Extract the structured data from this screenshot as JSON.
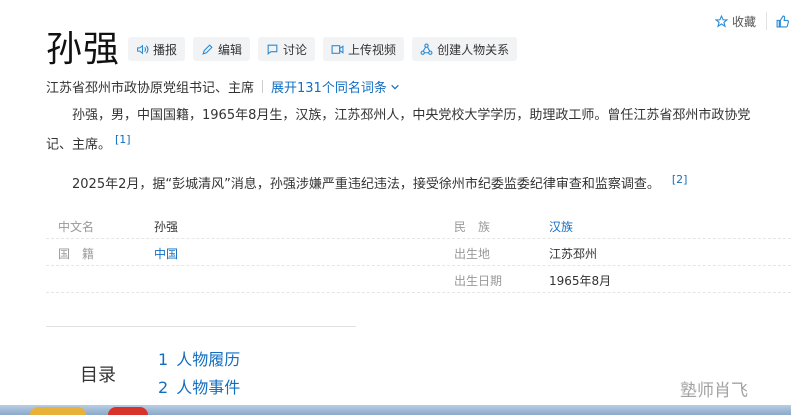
{
  "header": {
    "favorite_label": "收藏",
    "favorite_icon": "star-icon",
    "like_icon": "thumbs-up-icon"
  },
  "entry": {
    "title": "孙强",
    "toolbar": [
      {
        "icon": "speaker-icon",
        "label": "播报"
      },
      {
        "icon": "pencil-icon",
        "label": "编辑"
      },
      {
        "icon": "chat-icon",
        "label": "讨论"
      },
      {
        "icon": "video-icon",
        "label": "上传视频"
      },
      {
        "icon": "relation-icon",
        "label": "创建人物关系"
      }
    ],
    "subtitle": "江苏省邳州市政协原党组书记、主席",
    "expand_label": "展开131个同名词条"
  },
  "summary": {
    "p1_line1": "孙强，男，中国国籍，1965年8月生，汉族，江苏邳州人，中央党校大学学历，助理政工师。曾任江苏省邳州市政协党",
    "p1_line2": "记、主席。",
    "p1_ref": "[1]",
    "p2": "2025年2月，据“彭城清风”消息，孙强涉嫌严重违纪违法，接受徐州市纪委监委纪律审查和监察调查。",
    "p2_ref": "[2]"
  },
  "basic_info": {
    "rows": [
      {
        "k1": "中文名",
        "v1": "孙强",
        "k2": "民　族",
        "v2": "汉族"
      },
      {
        "k1": "国　籍",
        "v1": "中国",
        "k2": "出生地",
        "v2": "江苏邳州"
      },
      {
        "k1": "",
        "v1": "",
        "k2": "出生日期",
        "v2": "1965年8月"
      }
    ]
  },
  "toc": {
    "label": "目录",
    "items": [
      {
        "num": "1",
        "label": "人物履历"
      },
      {
        "num": "2",
        "label": "人物事件"
      }
    ]
  },
  "watermark": "塾师肖飞",
  "colors": {
    "link": "#136ec2",
    "tool_bg": "#f2f3f5"
  }
}
